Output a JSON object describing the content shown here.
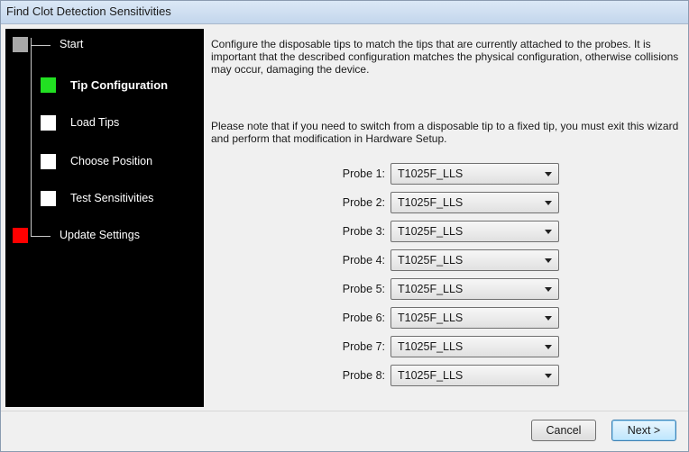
{
  "window": {
    "title": "Find Clot Detection Sensitivities"
  },
  "steps": [
    {
      "label": "Start",
      "color": "#a8a8a8",
      "current": false
    },
    {
      "label": "Tip Configuration",
      "color": "#22e022",
      "current": true
    },
    {
      "label": "Load Tips",
      "color": "#ffffff",
      "current": false
    },
    {
      "label": "Choose Position",
      "color": "#ffffff",
      "current": false
    },
    {
      "label": "Test Sensitivities",
      "color": "#ffffff",
      "current": false
    },
    {
      "label": "Update Settings",
      "color": "#ff0000",
      "current": false
    }
  ],
  "content": {
    "intro": "Configure the disposable tips to match the tips that are currently attached to the probes.  It is important that the described configuration matches the physical configuration, otherwise collisions may occur, damaging the device.",
    "note": "Please note that if you need to switch from a disposable tip to a fixed tip, you must exit this wizard and perform that modification in Hardware Setup."
  },
  "probes": [
    {
      "label": "Probe 1:",
      "value": "T1025F_LLS"
    },
    {
      "label": "Probe 2:",
      "value": "T1025F_LLS"
    },
    {
      "label": "Probe 3:",
      "value": "T1025F_LLS"
    },
    {
      "label": "Probe 4:",
      "value": "T1025F_LLS"
    },
    {
      "label": "Probe 5:",
      "value": "T1025F_LLS"
    },
    {
      "label": "Probe 6:",
      "value": "T1025F_LLS"
    },
    {
      "label": "Probe 7:",
      "value": "T1025F_LLS"
    },
    {
      "label": "Probe 8:",
      "value": "T1025F_LLS"
    }
  ],
  "buttons": {
    "cancel": "Cancel",
    "next": "Next >"
  }
}
